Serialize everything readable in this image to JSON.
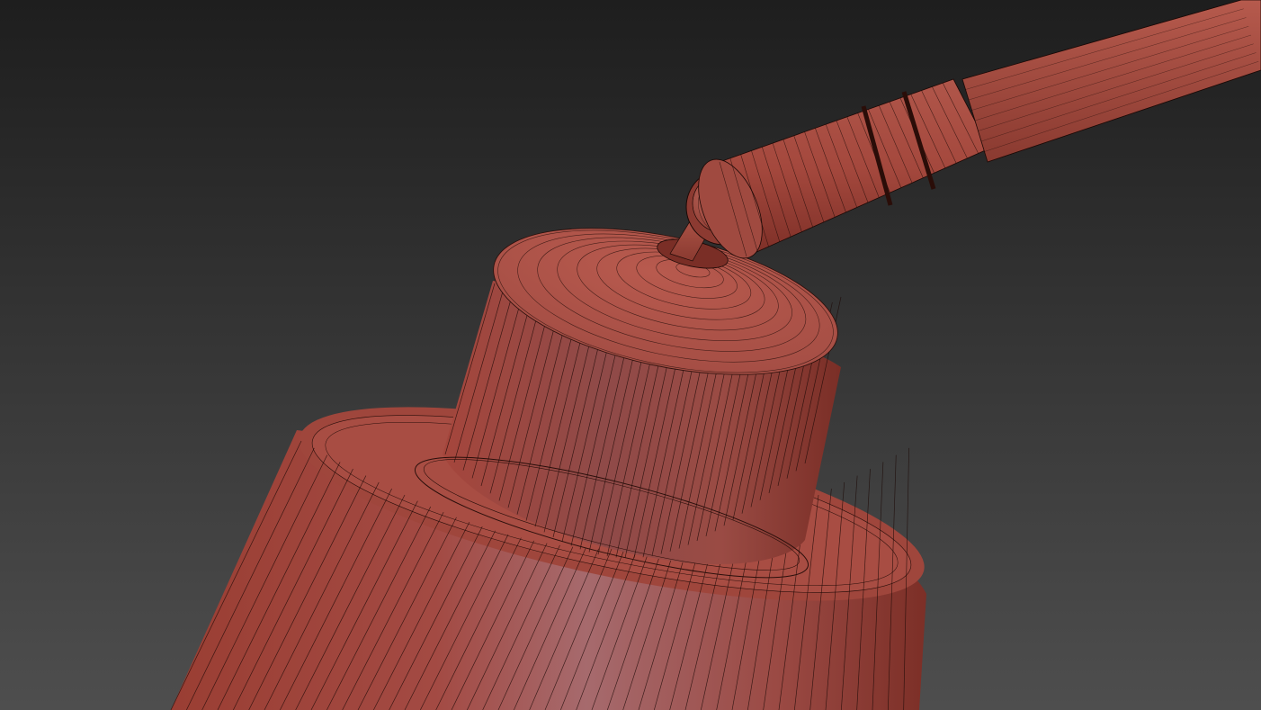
{
  "viewport": {
    "render_mode": "shaded-wireframe",
    "background_gradient": {
      "top": "#1e1e1e",
      "bottom": "#4e4e4e"
    },
    "material_color": "#a9493f",
    "material_highlight": "#a7696c",
    "material_shadow": "#6a2a22",
    "wire_color": "#1a0a08"
  },
  "model": {
    "parts": [
      "lamp-shade-base",
      "shade-collar",
      "shade-top-cap",
      "pivot-ball",
      "connector-rod",
      "arm-sleeve",
      "sleeve-rings",
      "arm-rod"
    ]
  }
}
